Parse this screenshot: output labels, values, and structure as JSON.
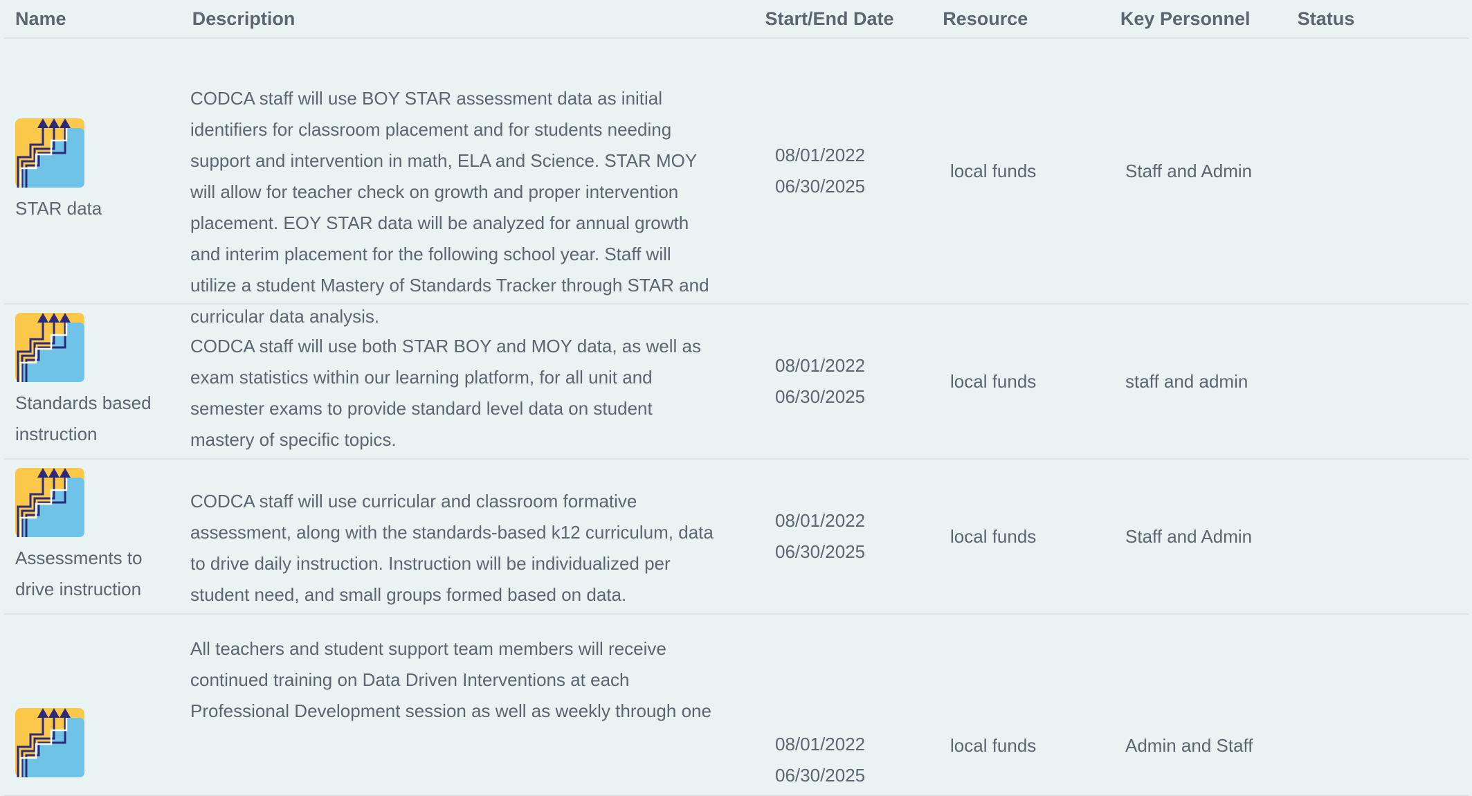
{
  "headers": {
    "name": "Name",
    "description": "Description",
    "date": "Start/End Date",
    "resource": "Resource",
    "personnel": "Key Personnel",
    "status": "Status"
  },
  "icon": "staircase-arrows-icon",
  "colors": {
    "background": "#eaf3f3",
    "icon_yellow": "#fcc84a",
    "icon_blue": "#6ec3e7",
    "icon_navy": "#2e2a7a"
  },
  "rows": [
    {
      "name_lines": [
        "STAR data"
      ],
      "description_lines": [
        "CODCA staff will use BOY STAR assessment data as initial",
        "identifiers for classroom placement and for students needing",
        "support and intervention in math, ELA and Science. STAR MOY",
        "will allow for teacher check on growth and proper intervention",
        "placement. EOY STAR data will be analyzed for annual growth",
        "and interim placement for the following school year. Staff will",
        "utilize a student Mastery of Standards Tracker through STAR and",
        "curricular data analysis."
      ],
      "start_date": "08/01/2022",
      "end_date": "06/30/2025",
      "resource": "local funds",
      "personnel": "Staff and Admin",
      "status": ""
    },
    {
      "name_lines": [
        "Standards based",
        "instruction"
      ],
      "description_lines": [
        "CODCA staff will use both STAR BOY and MOY data, as well as",
        "exam statistics within our learning platform, for all unit and",
        "semester exams to provide standard level data on student",
        "mastery of specific topics."
      ],
      "start_date": "08/01/2022",
      "end_date": "06/30/2025",
      "resource": "local funds",
      "personnel": "staff and admin",
      "status": ""
    },
    {
      "name_lines": [
        "Assessments to",
        "drive instruction"
      ],
      "description_lines": [
        "CODCA staff will use curricular and classroom formative",
        "assessment, along with the standards-based k12 curriculum, data",
        "to drive daily instruction. Instruction will be individualized per",
        "student need, and small groups formed based on data."
      ],
      "start_date": "08/01/2022",
      "end_date": "06/30/2025",
      "resource": "local funds",
      "personnel": "Staff and Admin",
      "status": ""
    },
    {
      "name_lines": [],
      "description_lines": [
        "All teachers and student support team members will receive",
        "continued training on Data Driven Interventions at each",
        "Professional Development session as well as weekly through one"
      ],
      "start_date": "08/01/2022",
      "end_date": "06/30/2025",
      "resource": "local funds",
      "personnel": "Admin and Staff",
      "status": ""
    }
  ]
}
